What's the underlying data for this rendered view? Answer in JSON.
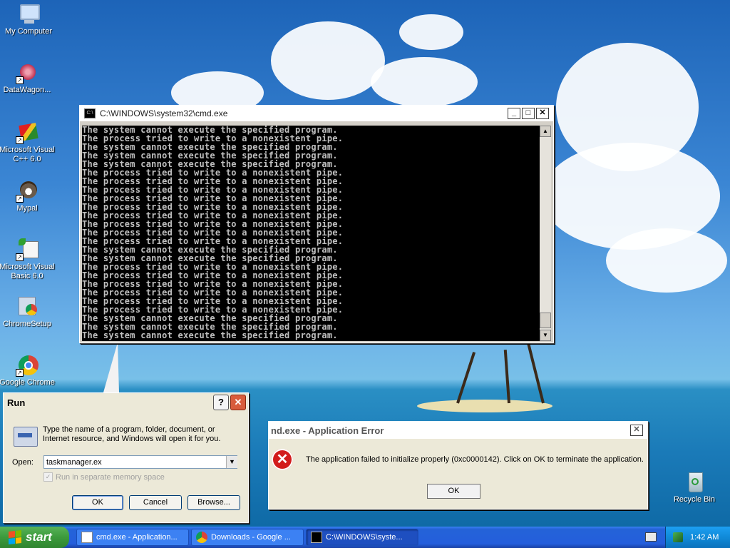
{
  "desktop_icons": [
    {
      "label": "My Computer"
    },
    {
      "label": "DataWagon..."
    },
    {
      "label": "Microsoft Visual C++ 6.0"
    },
    {
      "label": "Mypal"
    },
    {
      "label": "Microsoft Visual Basic 6.0"
    },
    {
      "label": "ChromeSetup"
    },
    {
      "label": "Google Chrome"
    },
    {
      "label": "Recycle Bin"
    }
  ],
  "cmd_window": {
    "title": "C:\\WINDOWS\\system32\\cmd.exe",
    "lines": [
      "The system cannot execute the specified program.",
      "The process tried to write to a nonexistent pipe.",
      "The system cannot execute the specified program.",
      "The system cannot execute the specified program.",
      "The system cannot execute the specified program.",
      "The process tried to write to a nonexistent pipe.",
      "The process tried to write to a nonexistent pipe.",
      "The process tried to write to a nonexistent pipe.",
      "The process tried to write to a nonexistent pipe.",
      "The process tried to write to a nonexistent pipe.",
      "The process tried to write to a nonexistent pipe.",
      "The process tried to write to a nonexistent pipe.",
      "The process tried to write to a nonexistent pipe.",
      "The process tried to write to a nonexistent pipe.",
      "The system cannot execute the specified program.",
      "The system cannot execute the specified program.",
      "The process tried to write to a nonexistent pipe.",
      "The process tried to write to a nonexistent pipe.",
      "The process tried to write to a nonexistent pipe.",
      "The process tried to write to a nonexistent pipe.",
      "The process tried to write to a nonexistent pipe.",
      "The process tried to write to a nonexistent pipe.",
      "The system cannot execute the specified program.",
      "The system cannot execute the specified program.",
      "The system cannot execute the specified program."
    ]
  },
  "run_dialog": {
    "title": "Run",
    "help_label": "?",
    "close_label": "✕",
    "description": "Type the name of a program, folder, document, or Internet resource, and Windows will open it for you.",
    "open_label": "Open:",
    "open_value": "taskmanager.ex",
    "checkbox_label": "Run in separate memory space",
    "ok_label": "OK",
    "cancel_label": "Cancel",
    "browse_label": "Browse..."
  },
  "error_dialog": {
    "title": "nd.exe - Application Error",
    "message": "The application failed to initialize properly (0xc0000142). Click on OK to terminate the application.",
    "ok_label": "OK"
  },
  "taskbar": {
    "start_label": "start",
    "tasks": [
      {
        "label": "cmd.exe - Application..."
      },
      {
        "label": "Downloads - Google ..."
      },
      {
        "label": "C:\\WINDOWS\\syste..."
      }
    ],
    "clock": "1:42 AM"
  },
  "colors": {
    "console_bg": "#000000",
    "console_fg": "#c0c0c0",
    "taskbar_blue": "#245edc",
    "start_green": "#3c9a3c",
    "error_red": "#d21c1c"
  }
}
